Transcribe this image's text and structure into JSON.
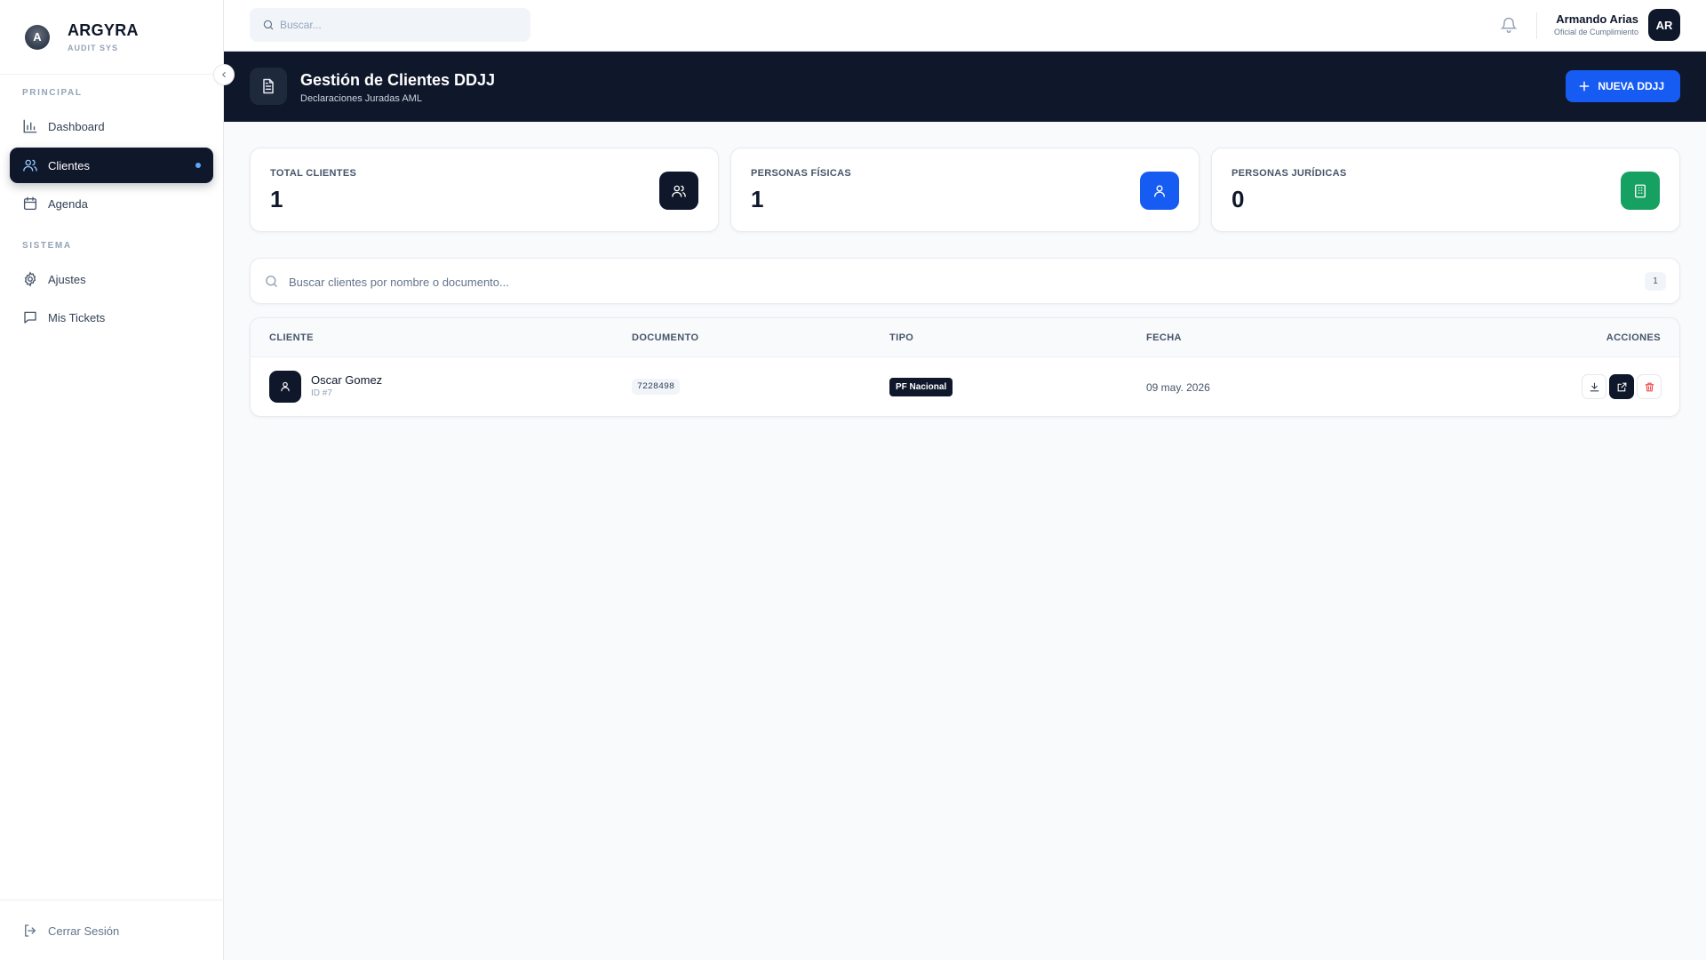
{
  "brand": {
    "name": "ARGYRA",
    "subtitle": "AUDIT SYS",
    "logo_letter": "A"
  },
  "sidebar": {
    "sections": [
      {
        "label": "PRINCIPAL",
        "items": [
          {
            "label": "Dashboard",
            "icon": "bar-chart-icon",
            "active": false
          },
          {
            "label": "Clientes",
            "icon": "users-icon",
            "active": true
          },
          {
            "label": "Agenda",
            "icon": "calendar-icon",
            "active": false
          }
        ]
      },
      {
        "label": "SISTEMA",
        "items": [
          {
            "label": "Ajustes",
            "icon": "gear-icon",
            "active": false
          },
          {
            "label": "Mis Tickets",
            "icon": "message-icon",
            "active": false
          }
        ]
      }
    ],
    "logout_label": "Cerrar Sesión",
    "collapse_icon": "chevron-left-icon"
  },
  "topbar": {
    "search_placeholder": "Buscar...",
    "user_name": "Armando Arias",
    "user_role": "Oficial de Cumplimiento",
    "user_initials": "AR"
  },
  "header": {
    "title": "Gestión de Clientes DDJJ",
    "subtitle": "Declaraciones Juradas AML",
    "new_button": "NUEVA DDJJ"
  },
  "stats": [
    {
      "label": "TOTAL CLIENTES",
      "value": "1",
      "icon": "users-icon",
      "color": "#0f172a"
    },
    {
      "label": "PERSONAS FÍSICAS",
      "value": "1",
      "icon": "user-icon",
      "color": "#175cf2"
    },
    {
      "label": "PERSONAS JURÍDICAS",
      "value": "0",
      "icon": "building-icon",
      "color": "#16a061"
    }
  ],
  "client_search": {
    "placeholder": "Buscar clientes por nombre o documento...",
    "count": "1"
  },
  "table": {
    "columns": [
      "CLIENTE",
      "DOCUMENTO",
      "TIPO",
      "FECHA",
      "ACCIONES"
    ],
    "rows": [
      {
        "name": "Oscar Gomez",
        "id": "ID #7",
        "documento": "7228498",
        "tipo": "PF Nacional",
        "fecha": "09 may. 2026"
      }
    ]
  }
}
